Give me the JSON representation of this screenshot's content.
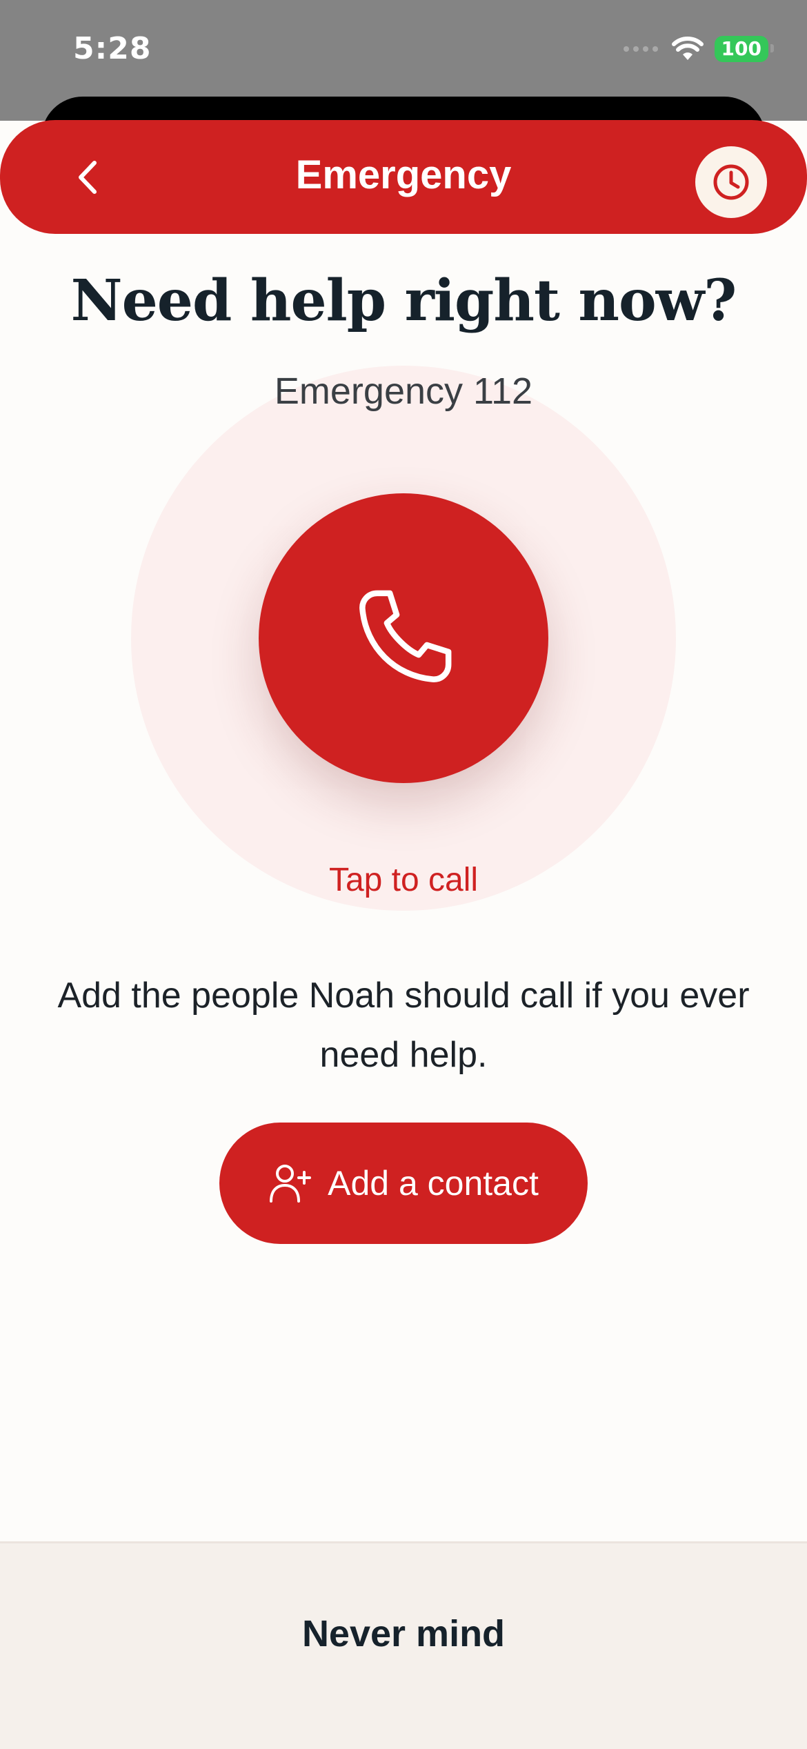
{
  "status_bar": {
    "time": "5:28",
    "battery": "100"
  },
  "header": {
    "title": "Emergency"
  },
  "main": {
    "headline": "Need help right now?",
    "subtitle": "Emergency 112",
    "tap_label": "Tap to call",
    "info_text": "Add the people Noah should call if you ever need help.",
    "add_contact_label": "Add a contact"
  },
  "footer": {
    "never_mind_label": "Never mind"
  },
  "icons": {
    "back": "chevron-left-icon",
    "history": "clock-icon",
    "call": "phone-icon",
    "add_contact": "user-plus-icon",
    "wifi": "wifi-icon",
    "battery": "battery-icon"
  },
  "colors": {
    "accent": "#cf2121",
    "halo": "#fcefee",
    "background": "#fdfcfa",
    "text_dark": "#16222b",
    "footer_bg": "#f5f0eb"
  }
}
